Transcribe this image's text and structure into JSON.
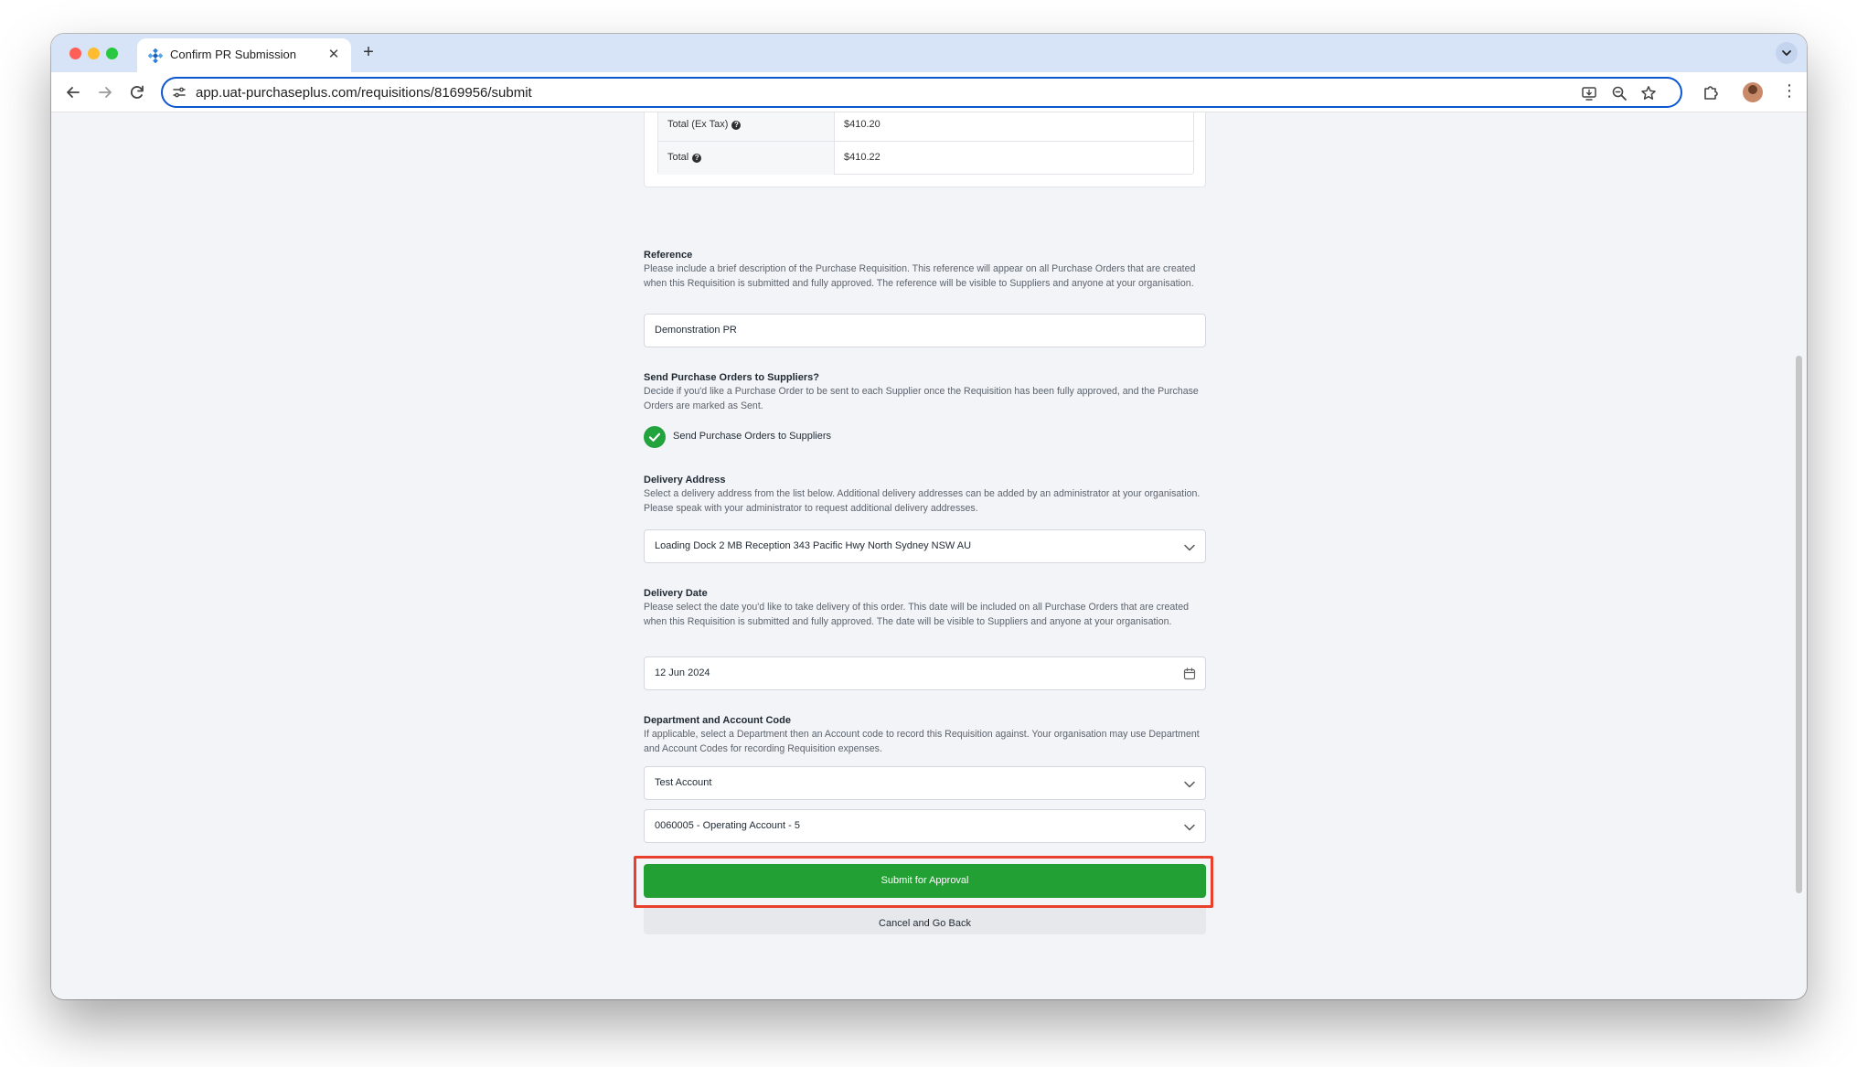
{
  "browser": {
    "tab_title": "Confirm PR Submission",
    "url": "app.uat-purchaseplus.com/requisitions/8169956/submit"
  },
  "summary": {
    "rows": [
      {
        "label": "Total (Ex Tax)",
        "value": "$410.20"
      },
      {
        "label": "Total",
        "value": "$410.22"
      }
    ]
  },
  "reference": {
    "title": "Reference",
    "help": "Please include a brief description of the Purchase Requisition. This reference will appear on all Purchase Orders that are created when this Requisition is submitted and fully approved. The reference will be visible to Suppliers and anyone at your organisation.",
    "value": "Demonstration PR"
  },
  "send_po": {
    "title": "Send Purchase Orders to Suppliers?",
    "help": "Decide if you'd like a Purchase Order to be sent to each Supplier once the Requisition has been fully approved, and the Purchase Orders are marked as Sent.",
    "checkbox_label": "Send Purchase Orders to Suppliers",
    "checked": true
  },
  "delivery_address": {
    "title": "Delivery Address",
    "help": "Select a delivery address from the list below. Additional delivery addresses can be added by an administrator at your organisation. Please speak with your administrator to request additional delivery addresses.",
    "value": "Loading Dock 2 MB Reception 343 Pacific Hwy North Sydney NSW AU"
  },
  "delivery_date": {
    "title": "Delivery Date",
    "help": "Please select the date you'd like to take delivery of this order. This date will be included on all Purchase Orders that are created when this Requisition is submitted and fully approved. The date will be visible to Suppliers and anyone at your organisation.",
    "value": "12 Jun 2024"
  },
  "department": {
    "title": "Department and Account Code",
    "help": "If applicable, select a Department then an Account code to record this Requisition against. Your organisation may use Department and Account Codes for recording Requisition expenses.",
    "department_value": "Test Account",
    "account_value": "0060005 - Operating Account - 5"
  },
  "actions": {
    "submit_label": "Submit for Approval",
    "cancel_label": "Cancel and Go Back"
  },
  "colors": {
    "accent_green": "#22a033",
    "highlight_red": "#e8402d"
  }
}
